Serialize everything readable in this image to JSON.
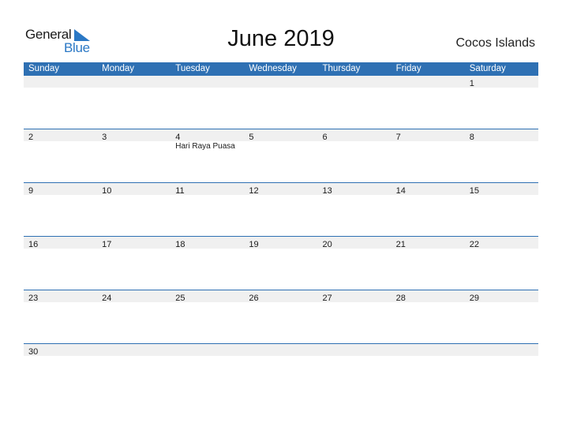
{
  "logo": {
    "word1": "General",
    "word2": "Blue"
  },
  "title": "June 2019",
  "region": "Cocos Islands",
  "colors": {
    "header_bg": "#2e70b3",
    "band_bg": "#f0f0f0",
    "logo_blue": "#2b78c5"
  },
  "weekdays": [
    "Sunday",
    "Monday",
    "Tuesday",
    "Wednesday",
    "Thursday",
    "Friday",
    "Saturday"
  ],
  "weeks": [
    {
      "days": [
        "",
        "",
        "",
        "",
        "",
        "",
        "1"
      ],
      "events": [
        "",
        "",
        "",
        "",
        "",
        "",
        ""
      ]
    },
    {
      "days": [
        "2",
        "3",
        "4",
        "5",
        "6",
        "7",
        "8"
      ],
      "events": [
        "",
        "",
        "Hari Raya Puasa",
        "",
        "",
        "",
        ""
      ]
    },
    {
      "days": [
        "9",
        "10",
        "11",
        "12",
        "13",
        "14",
        "15"
      ],
      "events": [
        "",
        "",
        "",
        "",
        "",
        "",
        ""
      ]
    },
    {
      "days": [
        "16",
        "17",
        "18",
        "19",
        "20",
        "21",
        "22"
      ],
      "events": [
        "",
        "",
        "",
        "",
        "",
        "",
        ""
      ]
    },
    {
      "days": [
        "23",
        "24",
        "25",
        "26",
        "27",
        "28",
        "29"
      ],
      "events": [
        "",
        "",
        "",
        "",
        "",
        "",
        ""
      ]
    },
    {
      "days": [
        "30",
        "",
        "",
        "",
        "",
        "",
        ""
      ],
      "events": [
        "",
        "",
        "",
        "",
        "",
        "",
        ""
      ]
    }
  ]
}
